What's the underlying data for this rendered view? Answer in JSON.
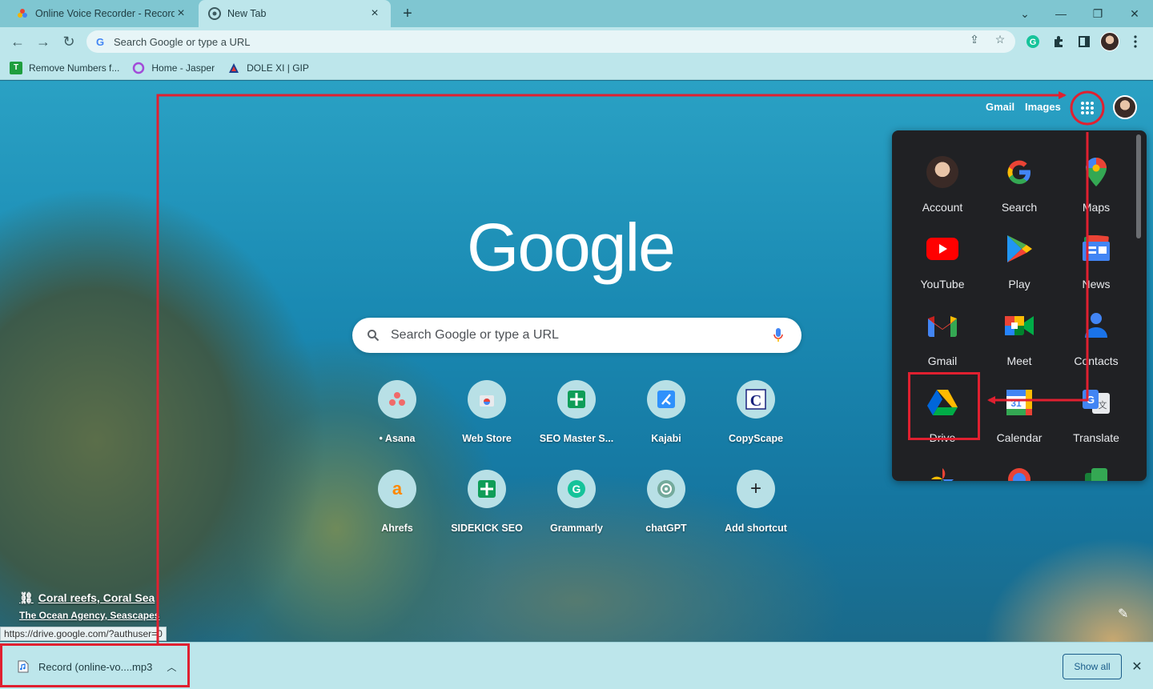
{
  "tabs": [
    {
      "title": "Online Voice Recorder - Record V",
      "active": false
    },
    {
      "title": "New Tab",
      "active": true
    }
  ],
  "omnibox": {
    "placeholder": "Search Google or type a URL"
  },
  "bookmarks": [
    {
      "label": "Remove Numbers f...",
      "icon": "t-square-icon"
    },
    {
      "label": "Home - Jasper",
      "icon": "jasper-icon"
    },
    {
      "label": "DOLE XI | GIP",
      "icon": "dole-icon"
    }
  ],
  "header": {
    "gmail": "Gmail",
    "images": "Images"
  },
  "search": {
    "placeholder": "Search Google or type a URL"
  },
  "logo": "Google",
  "shortcuts": [
    {
      "label": "• Asana"
    },
    {
      "label": "Web Store"
    },
    {
      "label": "SEO Master S..."
    },
    {
      "label": "Kajabi"
    },
    {
      "label": "CopyScape"
    },
    {
      "label": "Ahrefs"
    },
    {
      "label": "SIDEKICK SEO"
    },
    {
      "label": "Grammarly"
    },
    {
      "label": "chatGPT"
    },
    {
      "label": "Add shortcut"
    }
  ],
  "apps": [
    {
      "label": "Account"
    },
    {
      "label": "Search"
    },
    {
      "label": "Maps"
    },
    {
      "label": "YouTube"
    },
    {
      "label": "Play"
    },
    {
      "label": "News"
    },
    {
      "label": "Gmail"
    },
    {
      "label": "Meet"
    },
    {
      "label": "Contacts"
    },
    {
      "label": "Drive"
    },
    {
      "label": "Calendar"
    },
    {
      "label": "Translate"
    }
  ],
  "credit": {
    "title": "Coral reefs, Coral Sea",
    "author": "The Ocean Agency, Seascapes"
  },
  "status_url": "https://drive.google.com/?authuser=0",
  "download": {
    "filename": "Record (online-vo....mp3",
    "show_all": "Show all"
  },
  "colors": {
    "annotation": "#e02030",
    "panel_bg": "#202124",
    "chrome": "#bde6eb"
  }
}
